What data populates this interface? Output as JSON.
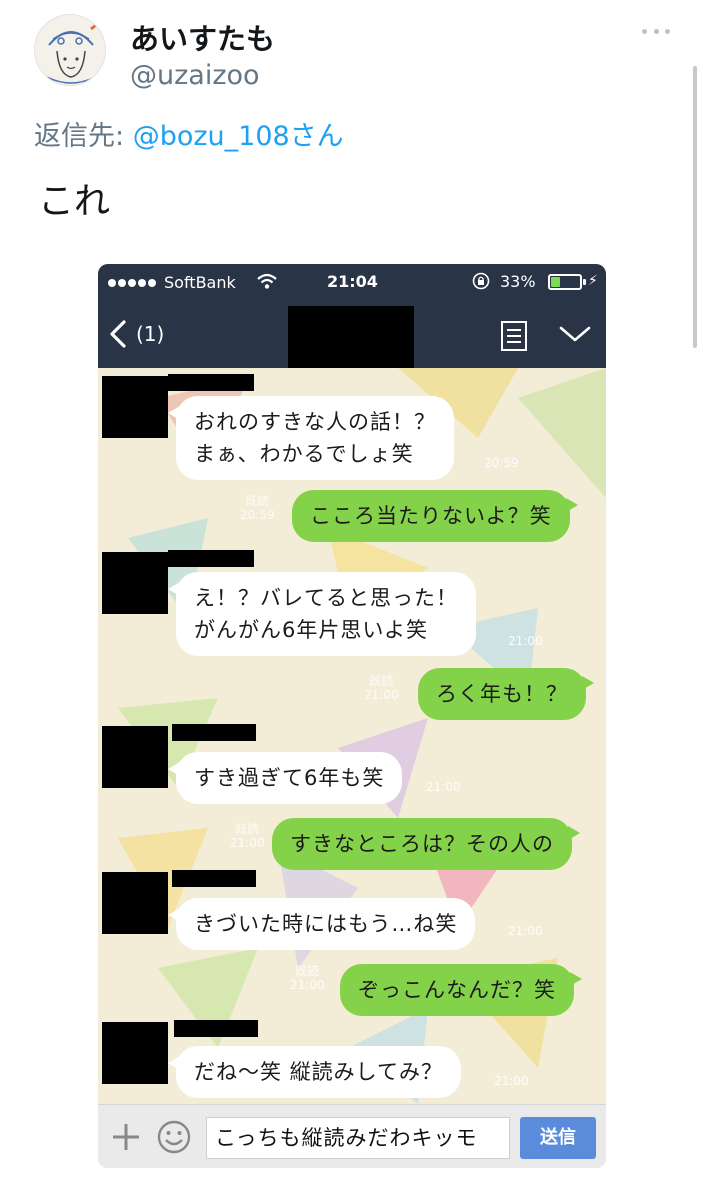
{
  "tweet": {
    "display_name": "あいすたも",
    "handle": "@uzaizoo",
    "reply_prefix": "返信先:",
    "reply_target": "@bozu_108さん",
    "text": "これ"
  },
  "screenshot": {
    "status_bar": {
      "carrier": "SoftBank",
      "time": "21:04",
      "battery": "33%",
      "battery_level": 0.33
    },
    "nav": {
      "back_count": "(1)"
    },
    "messages": [
      {
        "side": "in",
        "lines": [
          "おれのすきな人の話！？",
          "まぁ、わかるでしょ笑"
        ],
        "time": "20:59"
      },
      {
        "side": "out",
        "lines": [
          "こころ当たりないよ？笑"
        ],
        "read": "既読",
        "time": "20:59"
      },
      {
        "side": "in",
        "lines": [
          "え！？バレてると思った！",
          "がんがん6年片思いよ笑"
        ],
        "time": "21:00"
      },
      {
        "side": "out",
        "lines": [
          "ろく年も！？"
        ],
        "read": "既読",
        "time": "21:00"
      },
      {
        "side": "in",
        "lines": [
          "すき過ぎて6年も笑"
        ],
        "time": "21:00"
      },
      {
        "side": "out",
        "lines": [
          "すきなところは？その人の"
        ],
        "read": "既読",
        "time": "21:00"
      },
      {
        "side": "in",
        "lines": [
          "きづいた時にはもう…ね笑"
        ],
        "time": "21:00"
      },
      {
        "side": "out",
        "lines": [
          "ぞっこんなんだ？笑"
        ],
        "read": "既読",
        "time": "21:00"
      },
      {
        "side": "in",
        "lines": [
          "だね〜笑 縦読みしてみ？"
        ],
        "time": "21:00"
      }
    ],
    "input": {
      "value": "こっちも縦読みだわキッモ",
      "send_label": "送信"
    }
  },
  "colors": {
    "header_bg": "#2a3447",
    "chat_bg": "#f3ecd6",
    "bubble_out": "#84d24a",
    "link": "#1da1f2",
    "send_button": "#5b8cdb"
  }
}
